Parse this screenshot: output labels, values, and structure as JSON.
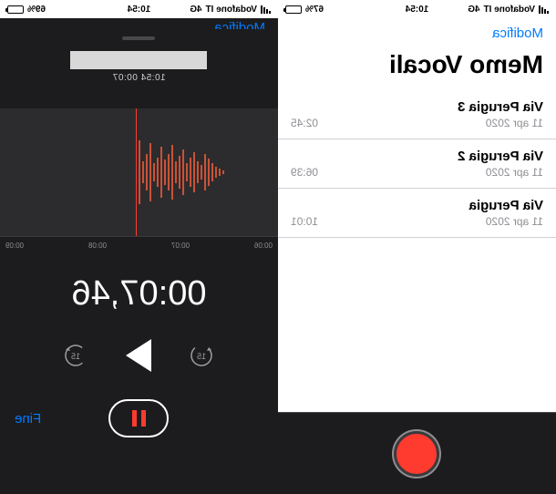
{
  "status": {
    "carrier": "Vodafone IT",
    "network": "4G",
    "time": "10:54",
    "battery_left": "67%",
    "battery_right": "69%"
  },
  "list_view": {
    "edit_label": "Modifica",
    "title": "Memo Vocali",
    "items": [
      {
        "name": "Via Perugia 3",
        "date": "11 apr 2020",
        "duration": "02:45"
      },
      {
        "name": "Via Perugia 2",
        "date": "11 apr 2020",
        "duration": "06:39"
      },
      {
        "name": "Via Perugia",
        "date": "11 apr 2020",
        "duration": "10:01"
      }
    ]
  },
  "recording_view": {
    "peek_edit_label": "Modifica",
    "subtime": "10:54  00:07",
    "ruler": [
      "00:06",
      "00:07",
      "00:08",
      "00:09"
    ],
    "elapsed": "00:07,46",
    "skip_seconds": "15",
    "done_label": "Fine"
  }
}
